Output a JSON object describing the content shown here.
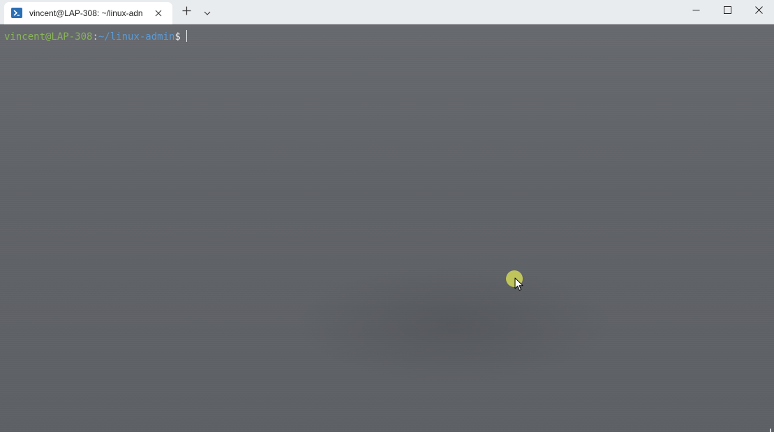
{
  "titlebar": {
    "tab": {
      "title": "vincent@LAP-308: ~/linux-adn",
      "icon": "terminal-icon"
    },
    "new_tab_icon": "plus-icon",
    "dropdown_icon": "chevron-down-icon",
    "window_controls": {
      "minimize_icon": "minimize-icon",
      "maximize_icon": "maximize-icon",
      "close_icon": "close-icon"
    }
  },
  "terminal": {
    "prompt": {
      "user_host": "vincent@LAP-308",
      "separator": ":",
      "path": "~/linux-admin",
      "symbol": "$"
    }
  },
  "colors": {
    "terminal_background": "#5f6368",
    "prompt_user": "#8ab459",
    "prompt_path": "#5b9bd5",
    "click_highlight": "#c8cd5a",
    "tab_icon_blue": "#2b6fb4"
  }
}
